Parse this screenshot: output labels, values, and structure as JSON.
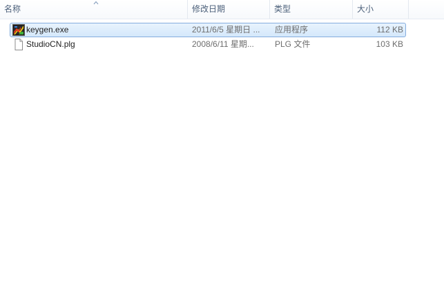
{
  "columns": {
    "name": "名称",
    "date": "修改日期",
    "type": "类型",
    "size": "大小"
  },
  "files": [
    {
      "name": "keygen.exe",
      "date": "2011/6/5 星期日 ...",
      "type": "应用程序",
      "size": "112 KB",
      "icon": "application-exe-icon",
      "selected": true
    },
    {
      "name": "StudioCN.plg",
      "date": "2008/6/11 星期...",
      "type": "PLG 文件",
      "size": "103 KB",
      "icon": "generic-file-icon",
      "selected": false
    }
  ],
  "colors": {
    "selection_fill": "#d5e8fb",
    "selection_border": "#84acdd",
    "header_text": "#4c607a"
  }
}
